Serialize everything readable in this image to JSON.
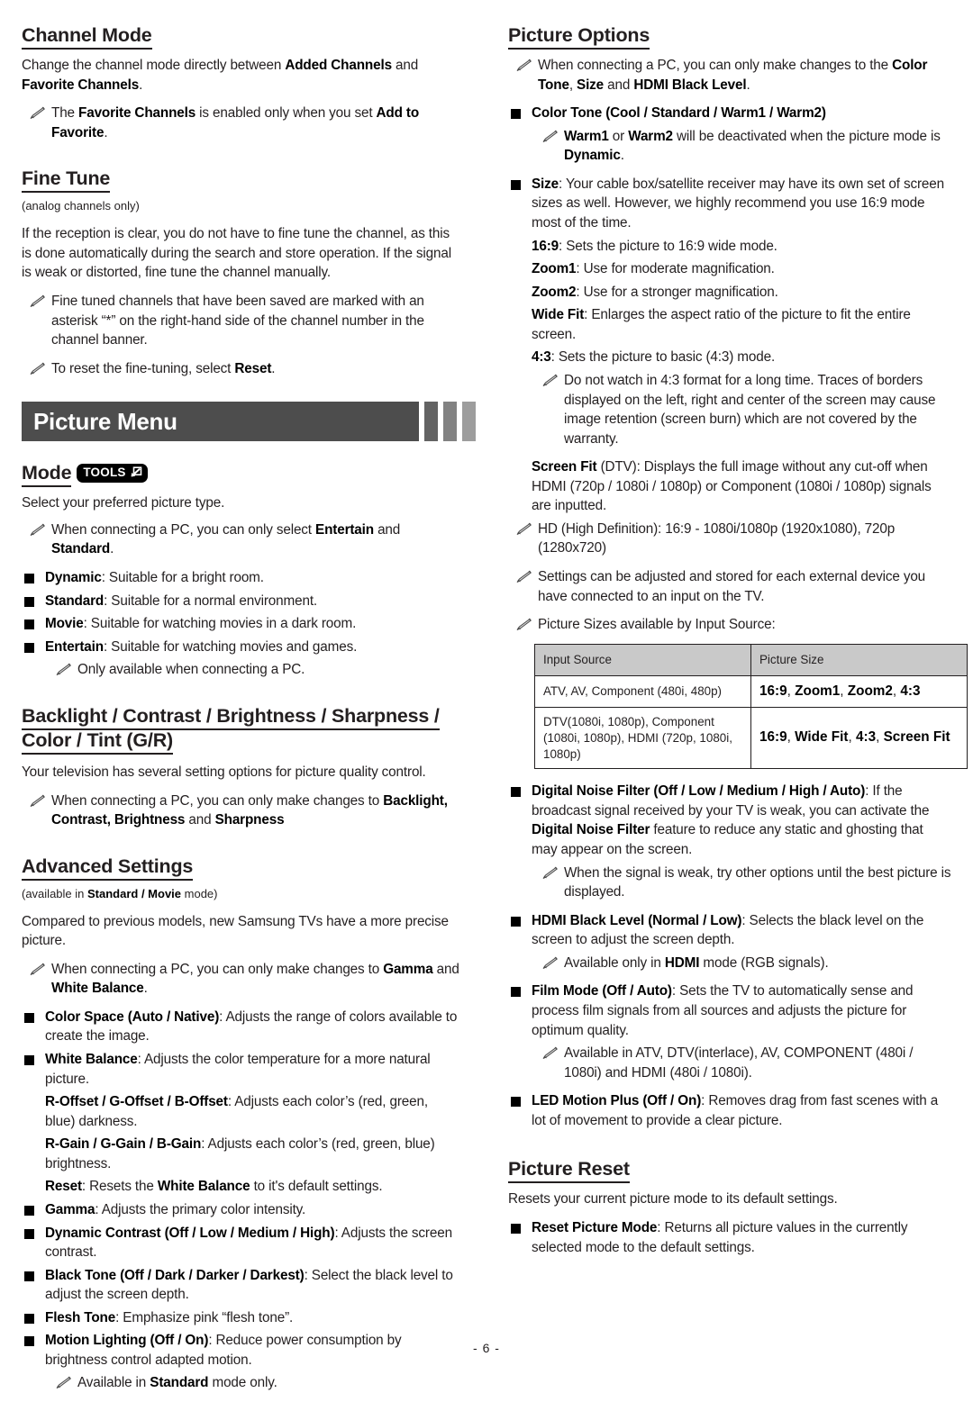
{
  "document": {
    "page_number_label": "- 6 -"
  },
  "left_column": {
    "channel_mode": {
      "heading": "Channel Mode",
      "body": "Change the channel mode directly between <b>Added Channels</b> and <b>Favorite Channels</b>.",
      "notes": [
        "The <b>Favorite Channels</b> is enabled only when you set <b>Add to Favorite</b>."
      ]
    },
    "fine_tune": {
      "heading": "Fine Tune",
      "subnote": "(analog channels only)",
      "body": "If the reception is clear, you do not have to fine tune the channel, as this is done automatically during the search and store operation. If the signal is weak or distorted, fine tune the channel manually.",
      "notes": [
        "Fine tuned channels that have been saved are marked with an asterisk “*” on the right-hand side of the channel number in the channel banner.",
        "To reset the fine-tuning, select <b>Reset</b>."
      ]
    },
    "picture_menu_banner": {
      "title": "Picture Menu",
      "bar_colors": [
        "#636363",
        "#828282",
        "#9d9d9d"
      ],
      "banner_color": "#4d4d4d"
    },
    "mode": {
      "heading": "Mode",
      "badge_label": "TOOLS",
      "badge_icon": "tools-arrow-icon",
      "body": "Select your preferred picture type.",
      "notes": [
        "When connecting a PC, you can only select <b>Entertain</b> and <b>Standard</b>."
      ],
      "items": [
        "<b>Dynamic</b>: Suitable for a bright room.",
        "<b>Standard</b>: Suitable for a normal environment.",
        "<b>Movie</b>: Suitable for watching movies in a dark room.",
        "<b>Entertain</b>: Suitable for watching movies and games."
      ],
      "item_sub_note": "Only available when connecting a PC."
    },
    "backlight_group": {
      "heading": "Backlight / Contrast / Brightness / Sharpness / Color / Tint (G/R)",
      "body": "Your television has several setting options for picture quality control.",
      "notes": [
        "When connecting a PC, you can only make changes to <b>Backlight, Contrast, Brightness</b> and <b>Sharpness</b>"
      ]
    },
    "advanced_settings": {
      "heading": "Advanced Settings",
      "subnote_html": "(available in <b>Standard / Movie</b> mode)",
      "body": "Compared to previous models, new Samsung TVs have a more precise picture.",
      "notes": [
        "When connecting a PC, you can only make changes to <b>Gamma</b> and <b>White Balance</b>."
      ],
      "items": [
        "<b>Color Space (Auto / Native)</b>: Adjusts the range of colors available to create the image.",
        "<b>White Balance</b>: Adjusts the color temperature for a more natural picture.",
        "<b>Gamma</b>: Adjusts the primary color intensity.",
        "<b>Dynamic Contrast (Off / Low / Medium / High)</b>: Adjusts the screen contrast.",
        "<b>Black Tone (Off / Dark / Darker / Darkest)</b>: Select the black level to adjust the screen depth.",
        "<b>Flesh Tone</b>: Emphasize pink “flesh tone”.",
        "<b>Motion Lighting (Off / On)</b>: Reduce power consumption by brightness control adapted motion."
      ],
      "white_balance_subitems": [
        "<b>R-Offset / G-Offset / B-Offset</b>: Adjusts each color’s (red, green, blue) darkness.",
        "<b>R-Gain / G-Gain / B-Gain</b>: Adjusts each color’s (red, green, blue) brightness.",
        "<b>Reset</b>: Resets the <b>White Balance</b> to it's default settings."
      ],
      "motion_lighting_note": "Available in <b>Standard</b> mode only."
    }
  },
  "right_column": {
    "picture_options": {
      "heading": "Picture Options",
      "notes_top": [
        "When connecting a PC, you can only make changes to the <b>Color Tone</b>, <b>Size</b> and <b>HDMI Black Level</b>."
      ],
      "color_tone": {
        "item": "<b>Color Tone (Cool / Standard / Warm1 / Warm2)</b>",
        "note": "<b>Warm1</b> or <b>Warm2</b> will be deactivated when the picture mode is <b>Dynamic</b>."
      },
      "size": {
        "item": "<b>Size</b>: Your cable box/satellite receiver may have its own set of screen sizes as well. However, we highly recommend you use 16:9 mode most of the time.",
        "options": [
          "<b>16:9</b>: Sets the picture to 16:9 wide mode.",
          "<b>Zoom1</b>: Use for moderate magnification.",
          "<b>Zoom2</b>: Use for a stronger magnification.",
          "<b>Wide Fit</b>: Enlarges the aspect ratio of the picture to fit the entire screen.",
          "<b>4:3</b>: Sets the picture to basic (4:3) mode."
        ],
        "four_three_note": "Do not watch in 4:3 format for a long time. Traces of borders displayed on the left, right and center of the screen may cause image retention (screen burn) which are not covered by the warranty.",
        "screen_fit": "<b>Screen Fit</b> (DTV): Displays the full image without any cut-off when HDMI (720p / 1080i / 1080p) or Component (1080i / 1080p) signals are inputted."
      },
      "notes_after_size": [
        "HD (High Definition): 16:9 - 1080i/1080p (1920x1080), 720p (1280x720)",
        "Settings can be adjusted and stored for each external device you have connected to an input on the TV.",
        "Picture Sizes available by Input Source:"
      ],
      "picture_size_table": {
        "headers": [
          "Input Source",
          "Picture Size"
        ],
        "rows": [
          {
            "source": "ATV, AV, Component (480i, 480p)",
            "size": "<b>16:9</b>, <b>Zoom1</b>, <b>Zoom2</b>, <b>4:3</b>"
          },
          {
            "source": "DTV(1080i, 1080p), Component (1080i, 1080p), HDMI (720p, 1080i, 1080p)",
            "size": "<b>16:9</b>, <b>Wide Fit</b>, <b>4:3</b>, <b>Screen Fit</b>"
          }
        ]
      },
      "items_after_table": [
        {
          "text": "<b>Digital Noise Filter (Off / Low / Medium / High / Auto)</b>: If the broadcast signal received by your TV is weak, you can activate the <b>Digital Noise Filter</b> feature to reduce any static and ghosting that may appear on the screen.",
          "note": "When the signal is weak, try other options until the best picture is displayed."
        },
        {
          "text": "<b>HDMI Black Level (Normal / Low)</b>: Selects the black level on the screen to adjust the screen depth.",
          "note": "Available only in <b>HDMI</b> mode (RGB signals)."
        },
        {
          "text": "<b>Film Mode (Off / Auto)</b>: Sets the TV to automatically sense and process film signals from all sources and adjusts the picture for optimum quality.",
          "note": "Available in ATV, DTV(interlace), AV, COMPONENT (480i / 1080i) and HDMI (480i / 1080i)."
        },
        {
          "text": "<b>LED Motion Plus (Off / On)</b>: Removes drag from fast scenes with a lot of movement to provide a clear picture.",
          "note": ""
        }
      ]
    },
    "picture_reset": {
      "heading": "Picture Reset",
      "body": "Resets your current picture mode to its default settings.",
      "items": [
        "<b>Reset Picture Mode</b>: Returns all picture values in the currently selected mode to the default settings."
      ]
    }
  }
}
